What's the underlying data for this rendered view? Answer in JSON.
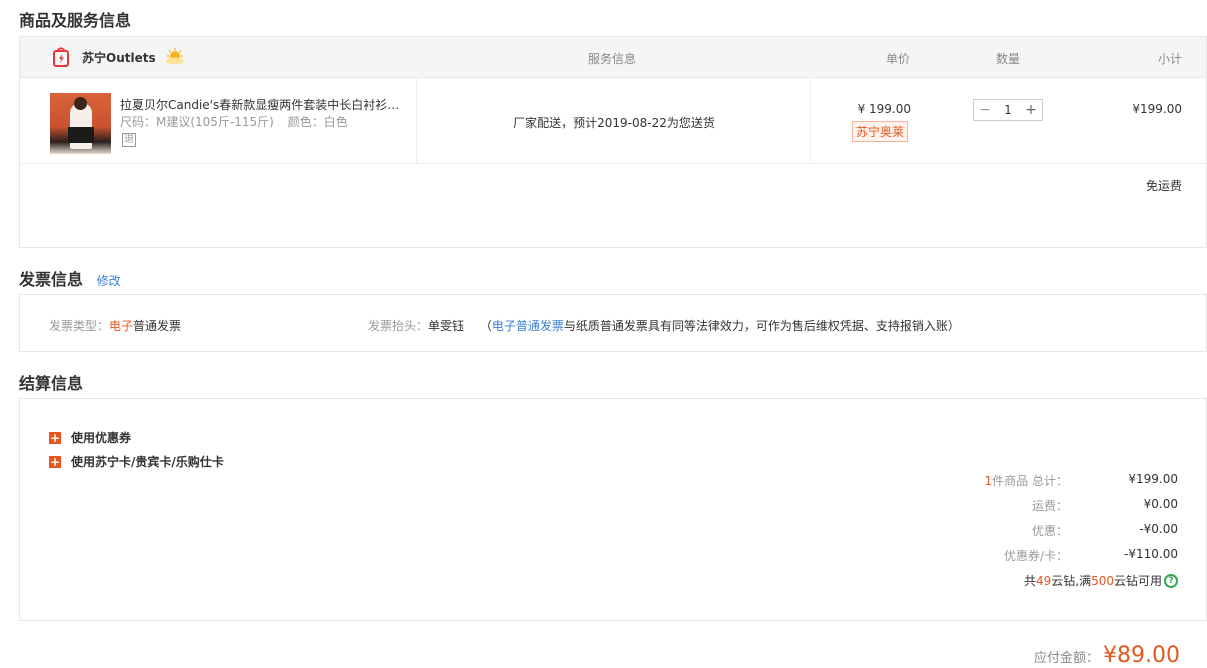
{
  "sections": {
    "goods_title": "商品及服务信息",
    "invoice_title": "发票信息",
    "invoice_edit": "修改",
    "settle_title": "结算信息"
  },
  "product_table": {
    "shop_name": "苏宁Outlets",
    "headers": {
      "service": "服务信息",
      "price": "单价",
      "quantity": "数量",
      "subtotal": "小计"
    },
    "item": {
      "name": "拉夏贝尔Candie's春新款显瘦两件套装中长白衬衫…",
      "size": "尺码：M建议(105斤-115斤)",
      "color": "颜色：白色",
      "return_badge": "退",
      "service": "厂家配送，预计2019-08-22为您送货",
      "price": "¥ 199.00",
      "price_tag": "苏宁奥莱",
      "quantity": "1",
      "minus": "−",
      "plus": "+",
      "subtotal": "¥199.00"
    },
    "shipping": "免运费"
  },
  "invoice": {
    "type_label": "发票类型：",
    "type_prefix": "电子",
    "type_value": "普通发票",
    "header_label": "发票抬头：",
    "header_value": "单雯钰",
    "note_open": "（",
    "note_link": "电子普通发票",
    "note_rest": "与纸质普通发票具有同等法律效力，可作为售后维权凭据、支持报销入账）"
  },
  "settlement": {
    "options": [
      "使用优惠券",
      "使用苏宁卡/贵宾卡/乐购仕卡"
    ],
    "count_prefix": "1",
    "count_label": "件商品 总计：",
    "total": "¥199.00",
    "shipping_label": "运费：",
    "shipping": "¥0.00",
    "discount_label": "优惠：",
    "discount": "-¥0.00",
    "coupon_label": "优惠券/卡：",
    "coupon": "-¥110.00",
    "coin_pre": "共 ",
    "coin_count": "49",
    "coin_mid": "云钻,满",
    "coin_threshold": "500",
    "coin_post": " 云钻可用"
  },
  "payable": {
    "label": "应付金额：",
    "amount": "¥89.00"
  },
  "colors": {
    "accent": "#e5571e",
    "link": "#3b7ed8",
    "help": "#2fa84f"
  }
}
